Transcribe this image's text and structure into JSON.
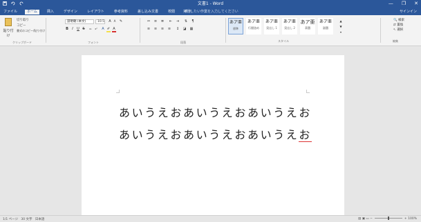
{
  "window": {
    "title": "文書1 - Word",
    "controls": [
      "—",
      "❐",
      "✕"
    ]
  },
  "quick_access": [
    "save-icon",
    "undo-icon",
    "redo-icon"
  ],
  "tabs": [
    {
      "label": "ファイル",
      "active": false
    },
    {
      "label": "ホーム",
      "active": true
    },
    {
      "label": "挿入",
      "active": false
    },
    {
      "label": "デザイン",
      "active": false
    },
    {
      "label": "レイアウト",
      "active": false
    },
    {
      "label": "参考資料",
      "active": false
    },
    {
      "label": "差し込み文書",
      "active": false
    },
    {
      "label": "校閲",
      "active": false
    },
    {
      "label": "表示",
      "active": false
    }
  ],
  "tell_me": "実行したい作業を入力してください",
  "sign_in": "サインイン",
  "ribbon": {
    "clipboard": {
      "paste": "貼り付け",
      "cut": "切り取り",
      "copy": "コピー",
      "format_painter": "書式のコピー/貼り付け",
      "label": "クリップボード"
    },
    "font": {
      "name": "游明朝 (本文)",
      "size": "10.5",
      "label": "フォント"
    },
    "paragraph": {
      "label": "段落"
    },
    "styles": {
      "items": [
        {
          "sample": "あア亜",
          "name": "標準"
        },
        {
          "sample": "あア亜",
          "name": "行間詰め"
        },
        {
          "sample": "あア亜",
          "name": "見出し 1"
        },
        {
          "sample": "あア亜",
          "name": "見出し 2"
        },
        {
          "sample": "あア亜",
          "name": "表題"
        },
        {
          "sample": "あア亜",
          "name": "副題"
        }
      ],
      "label": "スタイル"
    },
    "editing": {
      "find": "検索",
      "replace": "置換",
      "select": "選択",
      "label": "編集"
    },
    "accent": "#2b579a"
  },
  "document": {
    "lines": [
      "あいうえおあいうえおあいうえお",
      "あいうえおあいうえおあいうえ"
    ],
    "last_char": "お"
  },
  "status": {
    "page": "1/1 ページ",
    "words": "30 文字",
    "language": "日本語",
    "zoom": "100%"
  }
}
